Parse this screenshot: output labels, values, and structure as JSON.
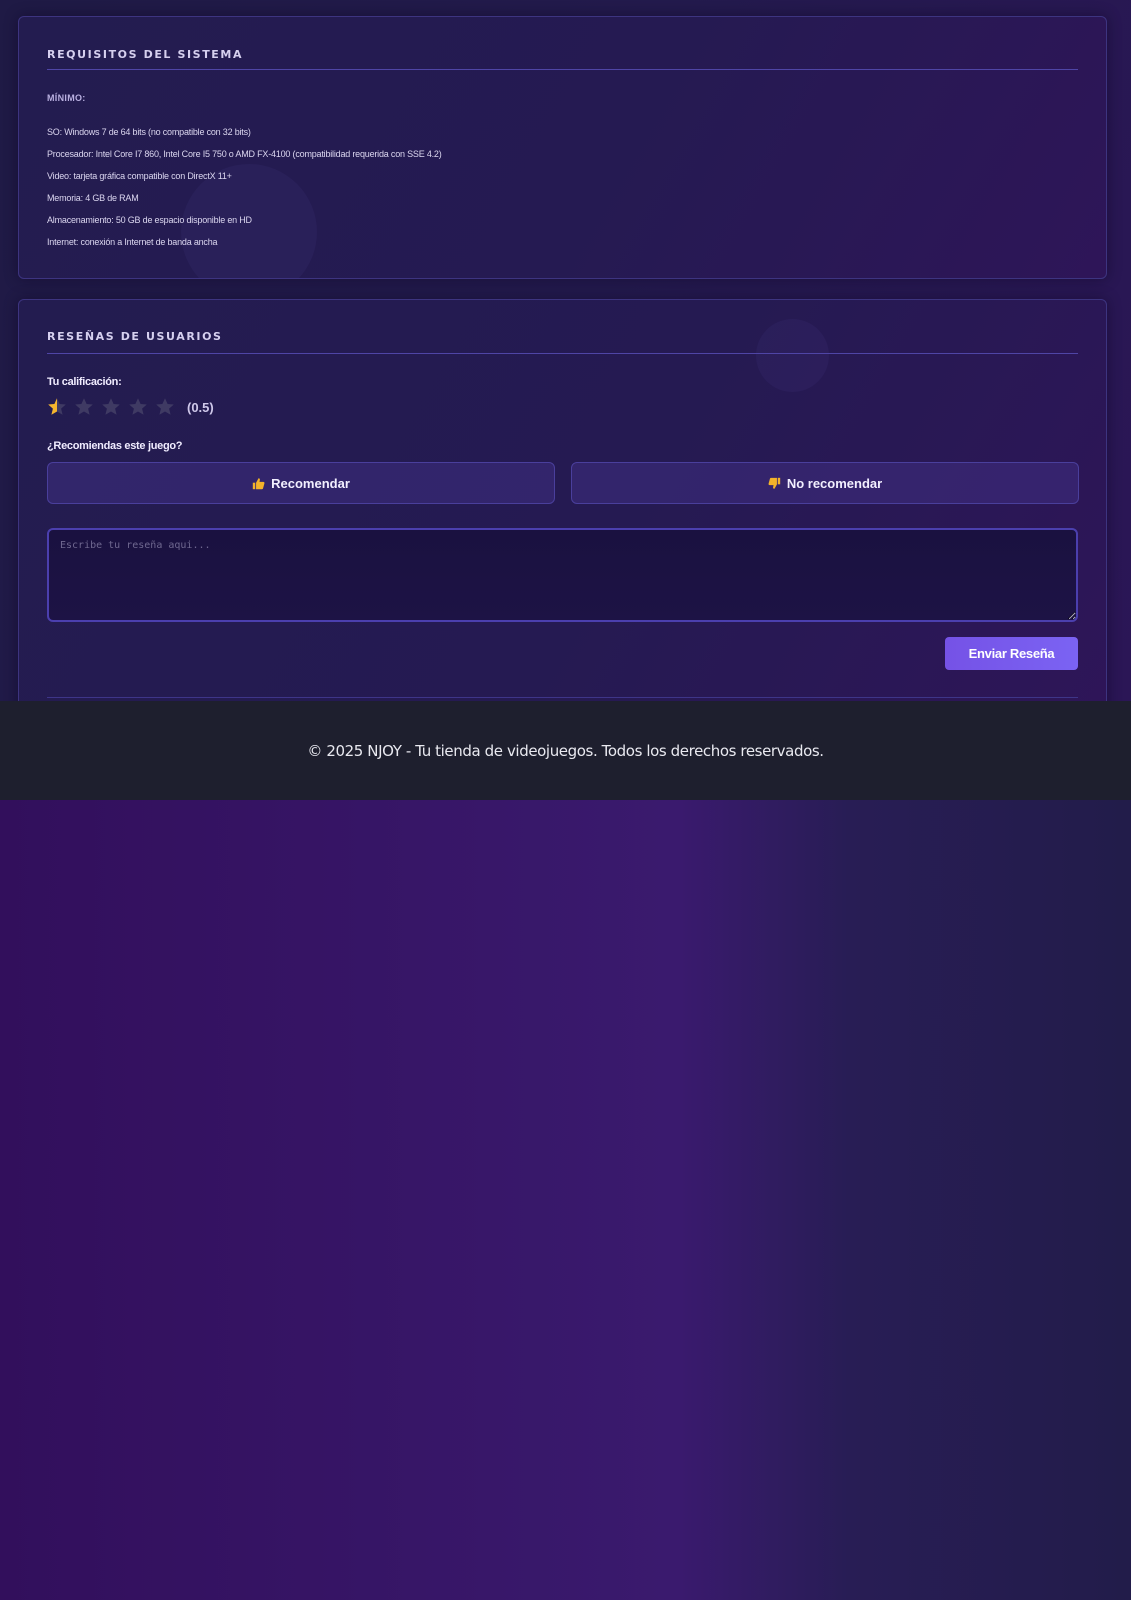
{
  "requirements": {
    "title": "REQUISITOS DEL SISTEMA",
    "minimum_heading": "MÍNIMO:",
    "items": [
      "SO: Windows 7 de 64 bits (no compatible con 32 bits)",
      "Procesador: Intel Core I7 860, Intel Core I5 750 o AMD FX-4100 (compatibilidad requerida con SSE 4.2)",
      "Video: tarjeta gráfica compatible con DirectX 11+",
      "Memoria: 4 GB de RAM",
      "Almacenamiento: 50 GB de espacio disponible en HD",
      "Internet: conexión a Internet de banda ancha"
    ]
  },
  "reviews": {
    "title": "RESEÑAS DE USUARIOS",
    "rating_label": "Tu calificación:",
    "rating": 0.5,
    "rating_max": 5,
    "rating_text": "(0.5)",
    "recommend_question": "¿Recomiendas este juego?",
    "recommend_label": "Recomendar",
    "not_recommend_label": "No recomendar",
    "recommend_icon": "thumbs-up-icon",
    "not_recommend_icon": "thumbs-down-icon",
    "review_placeholder": "Escribe tu reseña aqui...",
    "review_value": "",
    "submit_label": "Enviar Reseña"
  },
  "footer": {
    "text": "© 2025 NJOY - Tu tienda de videojuegos. Todos los derechos reservados."
  },
  "colors": {
    "star_filled": "#f5b52e",
    "star_empty": "#3f3a63",
    "accent": "#7552e6",
    "thumb": "#f3b32a"
  }
}
